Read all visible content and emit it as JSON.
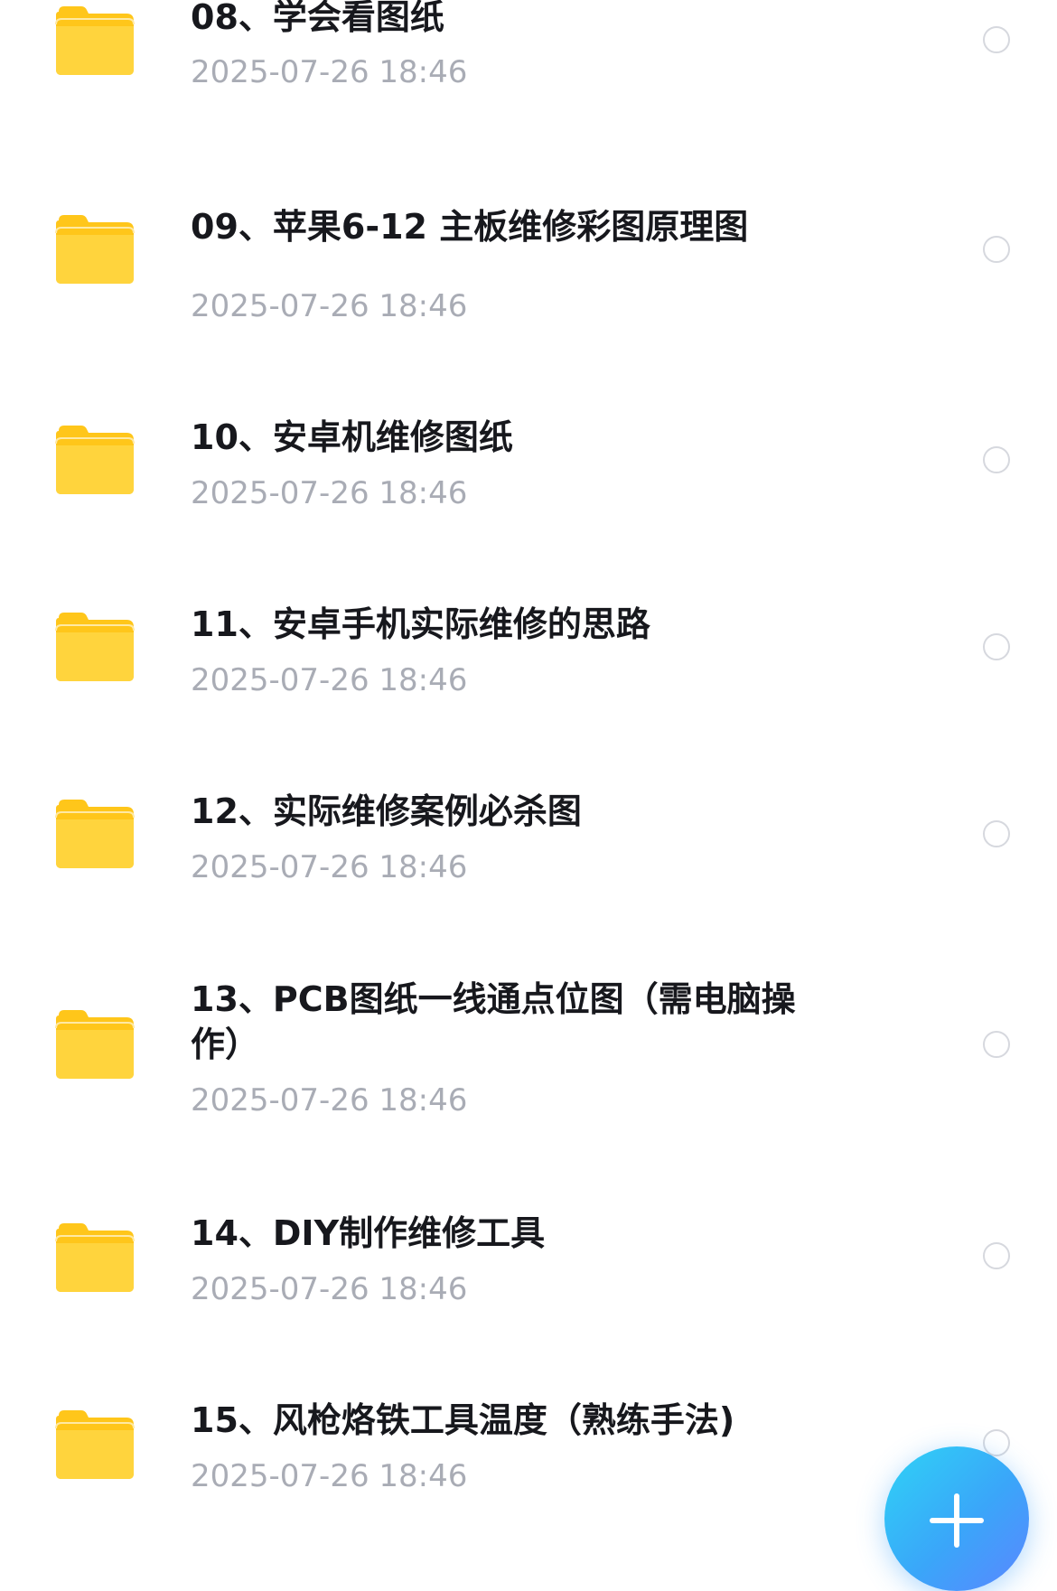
{
  "files": [
    {
      "name": "08、学会看图纸",
      "date": "2025-07-26 18:46",
      "icon": "folder-icon"
    },
    {
      "name": "09、苹果6-12 主板维修彩图原理图",
      "date": "2025-07-26 18:46",
      "icon": "folder-icon"
    },
    {
      "name": "10、安卓机维修图纸",
      "date": "2025-07-26 18:46",
      "icon": "folder-icon"
    },
    {
      "name": "11、安卓手机实际维修的思路",
      "date": "2025-07-26 18:46",
      "icon": "folder-icon"
    },
    {
      "name": "12、实际维修案例必杀图",
      "date": "2025-07-26 18:46",
      "icon": "folder-icon"
    },
    {
      "name": "13、PCB图纸一线通点位图（需电脑操作）",
      "date": "2025-07-26 18:46",
      "icon": "folder-icon"
    },
    {
      "name": "14、DIY制作维修工具",
      "date": "2025-07-26 18:46",
      "icon": "folder-icon"
    },
    {
      "name": "15、风枪烙铁工具温度（熟练手法)",
      "date": "2025-07-26 18:46",
      "icon": "folder-icon"
    }
  ],
  "fab": {
    "icon": "plus-icon"
  },
  "colors": {
    "folder": "#ffc61a",
    "title_text": "#17181d",
    "date_text": "#a9acb5",
    "radio_border": "#d6d8de",
    "fab_gradient_start": "#2fd3f6",
    "fab_gradient_end": "#5b86ff"
  }
}
